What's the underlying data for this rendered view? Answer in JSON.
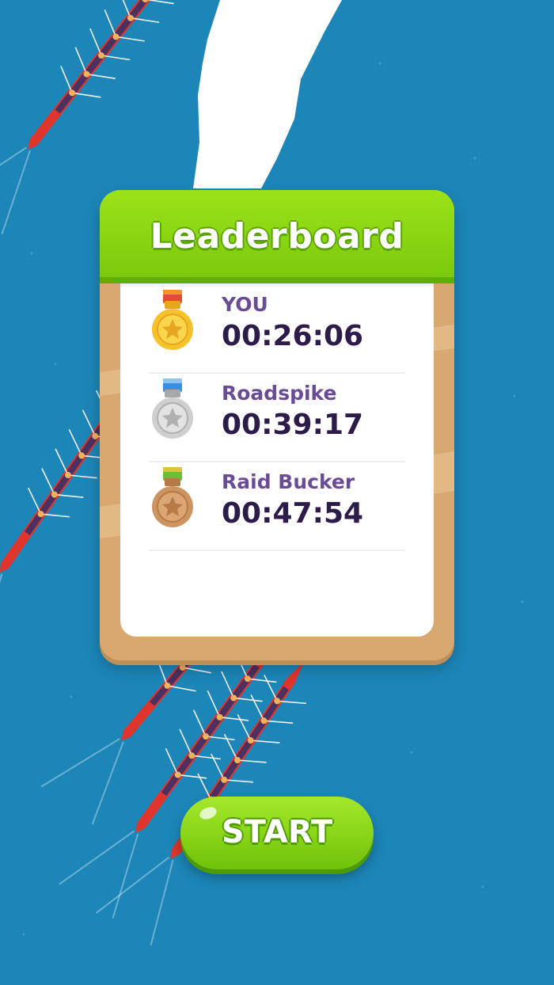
{
  "leaderboard": {
    "title": "Leaderboard",
    "entries": [
      {
        "name": "YOU",
        "time": "00:26:06",
        "medal": "gold-medal-icon"
      },
      {
        "name": "Roadspike",
        "time": "00:39:17",
        "medal": "silver-medal-icon"
      },
      {
        "name": "Raid Bucker",
        "time": "00:47:54",
        "medal": "bronze-medal-icon"
      }
    ]
  },
  "start_button": {
    "label": "START"
  },
  "colors": {
    "water": "#1c86b8",
    "header_green": "#8fd914",
    "frame_tan": "#d8a870",
    "name_purple": "#6a4c96",
    "time_dark": "#2c1c4a",
    "gold": "#f5c22a",
    "silver": "#cfcfcf",
    "bronze": "#cd9460"
  }
}
